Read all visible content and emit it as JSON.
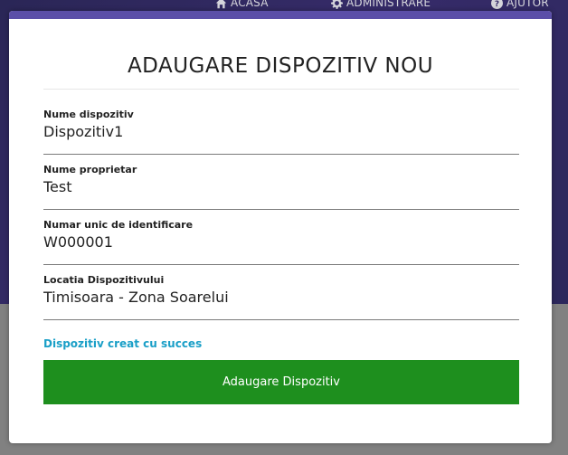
{
  "nav": {
    "acasa": "ACASA",
    "administrare": "ADMINISTRARE",
    "ajutor": "AJUTOR"
  },
  "modal": {
    "title": "ADAUGARE DISPOZITIV NOU",
    "fields": [
      {
        "label": "Nume dispozitiv",
        "value": "Dispozitiv1"
      },
      {
        "label": "Nume proprietar",
        "value": "Test"
      },
      {
        "label": "Numar unic de identificare",
        "value": "W000001"
      },
      {
        "label": "Locatia Dispozitivului",
        "value": "Timisoara - Zona Soarelui"
      }
    ],
    "success_message": "Dispozitiv creat cu succes",
    "submit_label": "Adaugare Dispozitiv"
  },
  "colors": {
    "accent": "#5b4fa8",
    "success_text": "#1a9fc7",
    "submit_bg": "#1e8f1e"
  },
  "icons": [
    "home-icon",
    "gear-icon",
    "help-icon"
  ]
}
